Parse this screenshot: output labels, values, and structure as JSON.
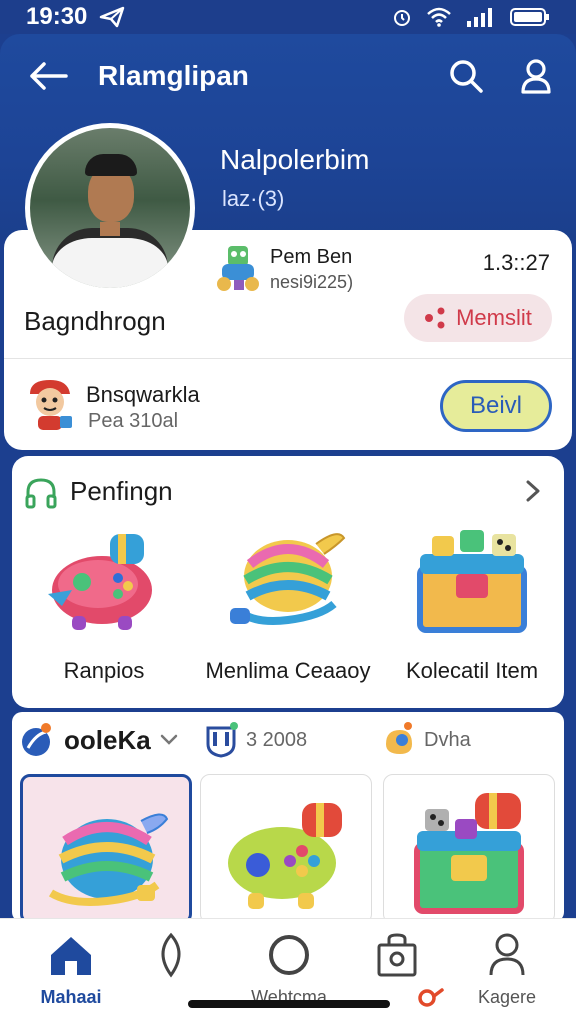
{
  "status": {
    "time": "19:30"
  },
  "nav": {
    "title": "Rlamglipan"
  },
  "user": {
    "name": "Nalpolerbim",
    "sub": "laz·(3)"
  },
  "player": {
    "name": "Bagndhrogn",
    "game_name": "Pem Ben",
    "game_sub": "nesi9i225)",
    "game_time": "1.3::27",
    "member_label": "Memslit"
  },
  "friend": {
    "name": "Bnsqwarkla",
    "sub": "Pea 310al",
    "action_label": "Beivl"
  },
  "pending": {
    "title": "Penfingn",
    "items": [
      {
        "label": "Ranpios",
        "icon": "controller-icon"
      },
      {
        "label": "Menlima Ceaaoy",
        "icon": "bowl-icon"
      },
      {
        "label": "Kolecatil Item",
        "icon": "chest-icon"
      }
    ]
  },
  "filters": {
    "first": "ooleKa",
    "second": "3 2008",
    "third": "Dvha"
  },
  "grid": [
    {
      "icon": "bowl-icon",
      "selected": true
    },
    {
      "icon": "controller-icon",
      "selected": false
    },
    {
      "icon": "chest-icon",
      "selected": false
    }
  ],
  "bottom_nav": {
    "items": [
      {
        "label": "Mahaai",
        "icon": "home-icon",
        "active": true
      },
      {
        "label": "",
        "icon": "leaf-icon",
        "active": false
      },
      {
        "label": "Wehtcma",
        "icon": "circle-icon",
        "active": false
      },
      {
        "label": "",
        "icon": "bag-icon",
        "active": false
      },
      {
        "label": "Kagere",
        "icon": "person-icon",
        "active": false
      }
    ]
  },
  "colors": {
    "primary": "#1f4a9e",
    "member_bg": "#f4e4e7",
    "member_text": "#d03a4a",
    "beli_bg": "#e6ec9a"
  }
}
